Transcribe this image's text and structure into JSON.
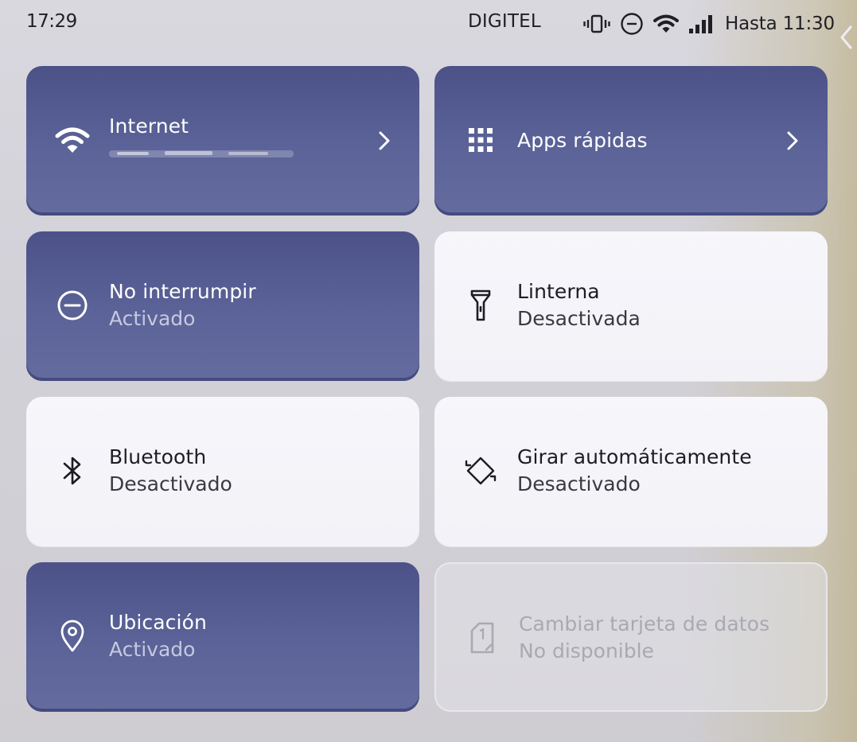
{
  "status_bar": {
    "time": "17:29",
    "carrier": "DIGITEL",
    "until": "Hasta 11:30",
    "icons": [
      "vibrate-icon",
      "do-not-disturb-icon",
      "wifi-icon",
      "signal-icon"
    ]
  },
  "colors": {
    "active_tile": "#5860a0",
    "inactive_tile": "#f5f5fa",
    "background": "#d4d3d9"
  },
  "tiles": {
    "internet": {
      "title": "Internet",
      "icon": "wifi-icon",
      "state": "active",
      "subtitle_redacted": true
    },
    "quick_apps": {
      "title": "Apps rápidas",
      "icon": "grid-icon",
      "state": "active"
    },
    "dnd": {
      "title": "No interrumpir",
      "subtitle": "Activado",
      "icon": "do-not-disturb-icon",
      "state": "active"
    },
    "flashlight": {
      "title": "Linterna",
      "subtitle": "Desactivada",
      "icon": "flashlight-icon",
      "state": "inactive"
    },
    "bluetooth": {
      "title": "Bluetooth",
      "subtitle": "Desactivado",
      "icon": "bluetooth-icon",
      "state": "inactive"
    },
    "rotate": {
      "title": "Girar automáticamente",
      "subtitle": "Desactivado",
      "icon": "auto-rotate-icon",
      "state": "inactive"
    },
    "location": {
      "title": "Ubicación",
      "subtitle": "Activado",
      "icon": "location-pin-icon",
      "state": "active"
    },
    "data_card": {
      "title": "Cambiar tarjeta de datos",
      "subtitle": "No disponible",
      "icon": "sim-card-icon",
      "state": "disabled"
    }
  }
}
